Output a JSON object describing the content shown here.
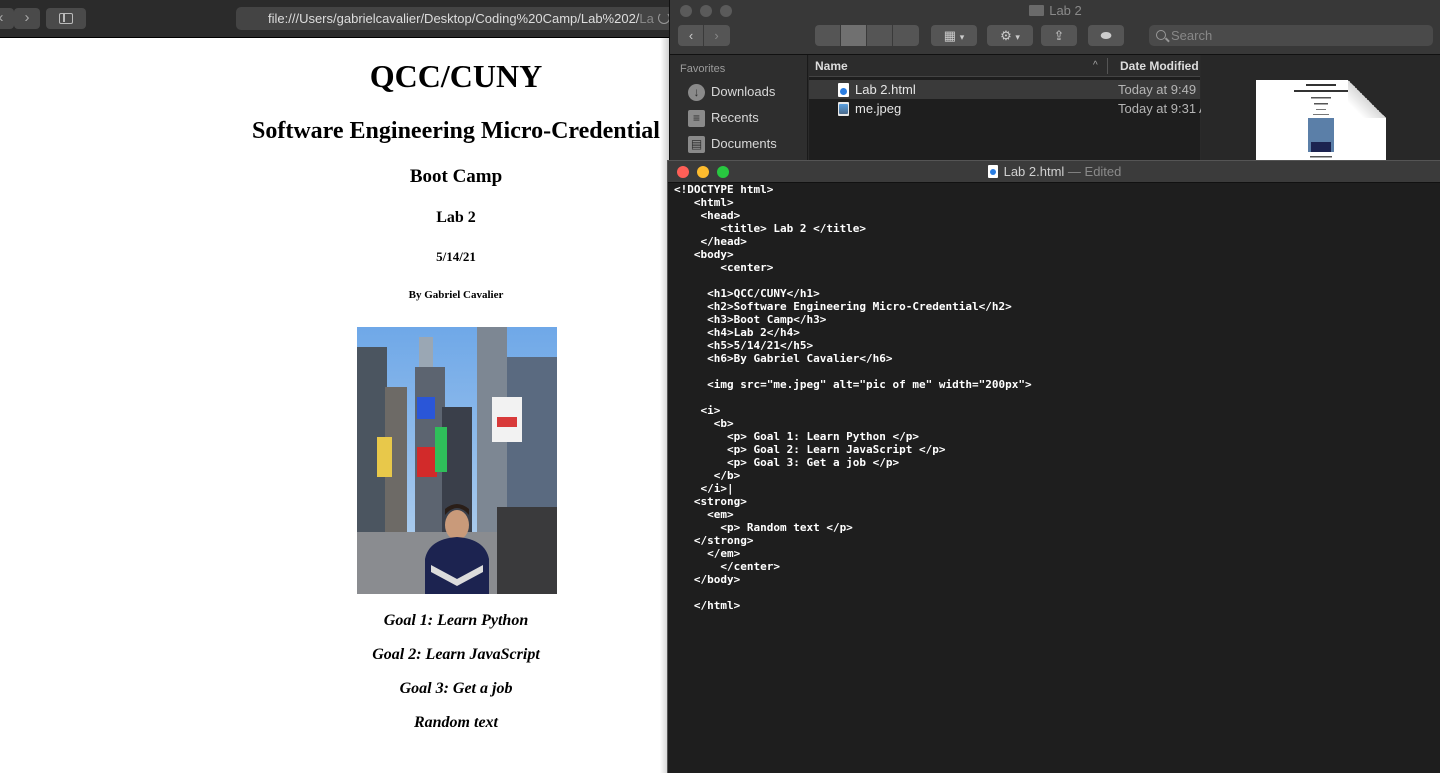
{
  "browser": {
    "url": "file:///Users/gabrielcavalier/Desktop/Coding%20Camp/Lab%202/",
    "url_fade": "La",
    "back_icon": "chevron-left-icon",
    "forward_icon": "chevron-right-icon",
    "sidebar_icon": "sidebar-icon",
    "reload_icon": "reload-icon"
  },
  "page": {
    "h1": "QCC/CUNY",
    "h2": "Software Engineering Micro-Credential",
    "h3": "Boot Camp",
    "h4": "Lab 2",
    "h5": "5/14/21",
    "h6": "By Gabriel Cavalier",
    "goals": [
      "Goal 1: Learn Python",
      "Goal 2: Learn JavaScript",
      "Goal 3: Get a job"
    ],
    "random": "Random text"
  },
  "finder": {
    "title": "Lab 2",
    "search_placeholder": "Search",
    "favorites_heading": "Favorites",
    "favorites": [
      {
        "label": "Downloads",
        "icon": "download-icon"
      },
      {
        "label": "Recents",
        "icon": "recents-icon"
      },
      {
        "label": "Documents",
        "icon": "document-icon"
      }
    ],
    "columns": {
      "name": "Name",
      "date": "Date Modified"
    },
    "files": [
      {
        "name": "Lab 2.html",
        "date": "Today at 9:49",
        "icon": "html-file-icon"
      },
      {
        "name": "me.jpeg",
        "date": "Today at 9:31 A",
        "icon": "image-file-icon"
      }
    ]
  },
  "editor": {
    "filename": "Lab 2.html",
    "status": " — Edited",
    "lines": [
      "<!DOCTYPE html>",
      "   <html>",
      "    <head>",
      "       <title> Lab 2 </title>",
      "    </head>",
      "   <body>",
      "       <center>",
      "",
      "     <h1>QCC/CUNY</h1>",
      "     <h2>Software Engineering Micro-Credential</h2>",
      "     <h3>Boot Camp</h3>",
      "     <h4>Lab 2</h4>",
      "     <h5>5/14/21</h5>",
      "     <h6>By Gabriel Cavalier</h6>",
      "",
      "     <img src=\"me.jpeg\" alt=\"pic of me\" width=\"200px\">",
      "",
      "    <i>",
      "      <b>",
      "        <p> Goal 1: Learn Python </p>",
      "        <p> Goal 2: Learn JavaScript </p>",
      "        <p> Goal 3: Get a job </p>",
      "      </b>",
      "    </i>|",
      "   <strong>",
      "     <em>",
      "       <p> Random text </p>",
      "   </strong>",
      "     </em>",
      "       </center>",
      "   </body>",
      "",
      "   </html>"
    ]
  },
  "colors": {
    "close": "#ff5f57",
    "minimize": "#febc2e",
    "zoom": "#28c840",
    "inactive_light": "#5a5a5a"
  }
}
